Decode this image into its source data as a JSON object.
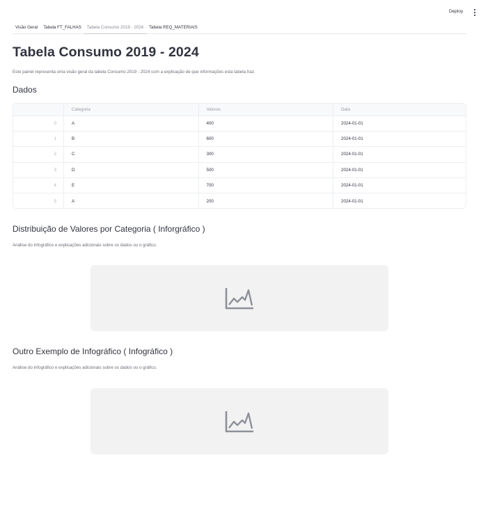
{
  "header": {
    "deploy_label": "Deploy",
    "menu_icon": "kebab-menu-icon"
  },
  "tabs": [
    {
      "label": "Visão Geral",
      "active": false
    },
    {
      "label": "Tabela FT_FALHAS",
      "active": false
    },
    {
      "label": "Tabela Consumo 2019 - 2024",
      "active": true
    },
    {
      "label": "Tabela REQ_MATERIAIS",
      "active": false
    }
  ],
  "page": {
    "title": "Tabela Consumo 2019 - 2024",
    "description": "Este painel representa uma visão geral da tabela Consumo 2019 - 2024 com a explicação de que informações esta tabela traz."
  },
  "data_section": {
    "heading": "Dados",
    "columns": [
      "",
      "Categoria",
      "Valores",
      "Data"
    ],
    "rows": [
      {
        "index": "0",
        "categoria": "A",
        "valores": "400",
        "data": "2024-01-01"
      },
      {
        "index": "1",
        "categoria": "B",
        "valores": "600",
        "data": "2024-01-01"
      },
      {
        "index": "2",
        "categoria": "C",
        "valores": "300",
        "data": "2024-01-01"
      },
      {
        "index": "3",
        "categoria": "D",
        "valores": "500",
        "data": "2024-01-01"
      },
      {
        "index": "4",
        "categoria": "E",
        "valores": "700",
        "data": "2024-01-01"
      },
      {
        "index": "5",
        "categoria": "A",
        "valores": "200",
        "data": "2024-01-01"
      }
    ]
  },
  "infographics": [
    {
      "heading": "Distribuição de Valores por Categoria ( Inforgráfico )",
      "description": "Análise do infográfico e explicações adicionais sobre os dados ou o gráfico.",
      "icon": "area-chart-icon"
    },
    {
      "heading": "Outro Exemplo de Infográfico ( Infográfico )",
      "description": "Análise do infográfico e explicações adicionais sobre os dados ou o gráfico.",
      "icon": "area-chart-icon"
    }
  ],
  "colors": {
    "text": "#31333f",
    "muted": "#6b6d78",
    "placeholder_bg": "#f2f2f3",
    "icon": "#9a9ca6"
  }
}
